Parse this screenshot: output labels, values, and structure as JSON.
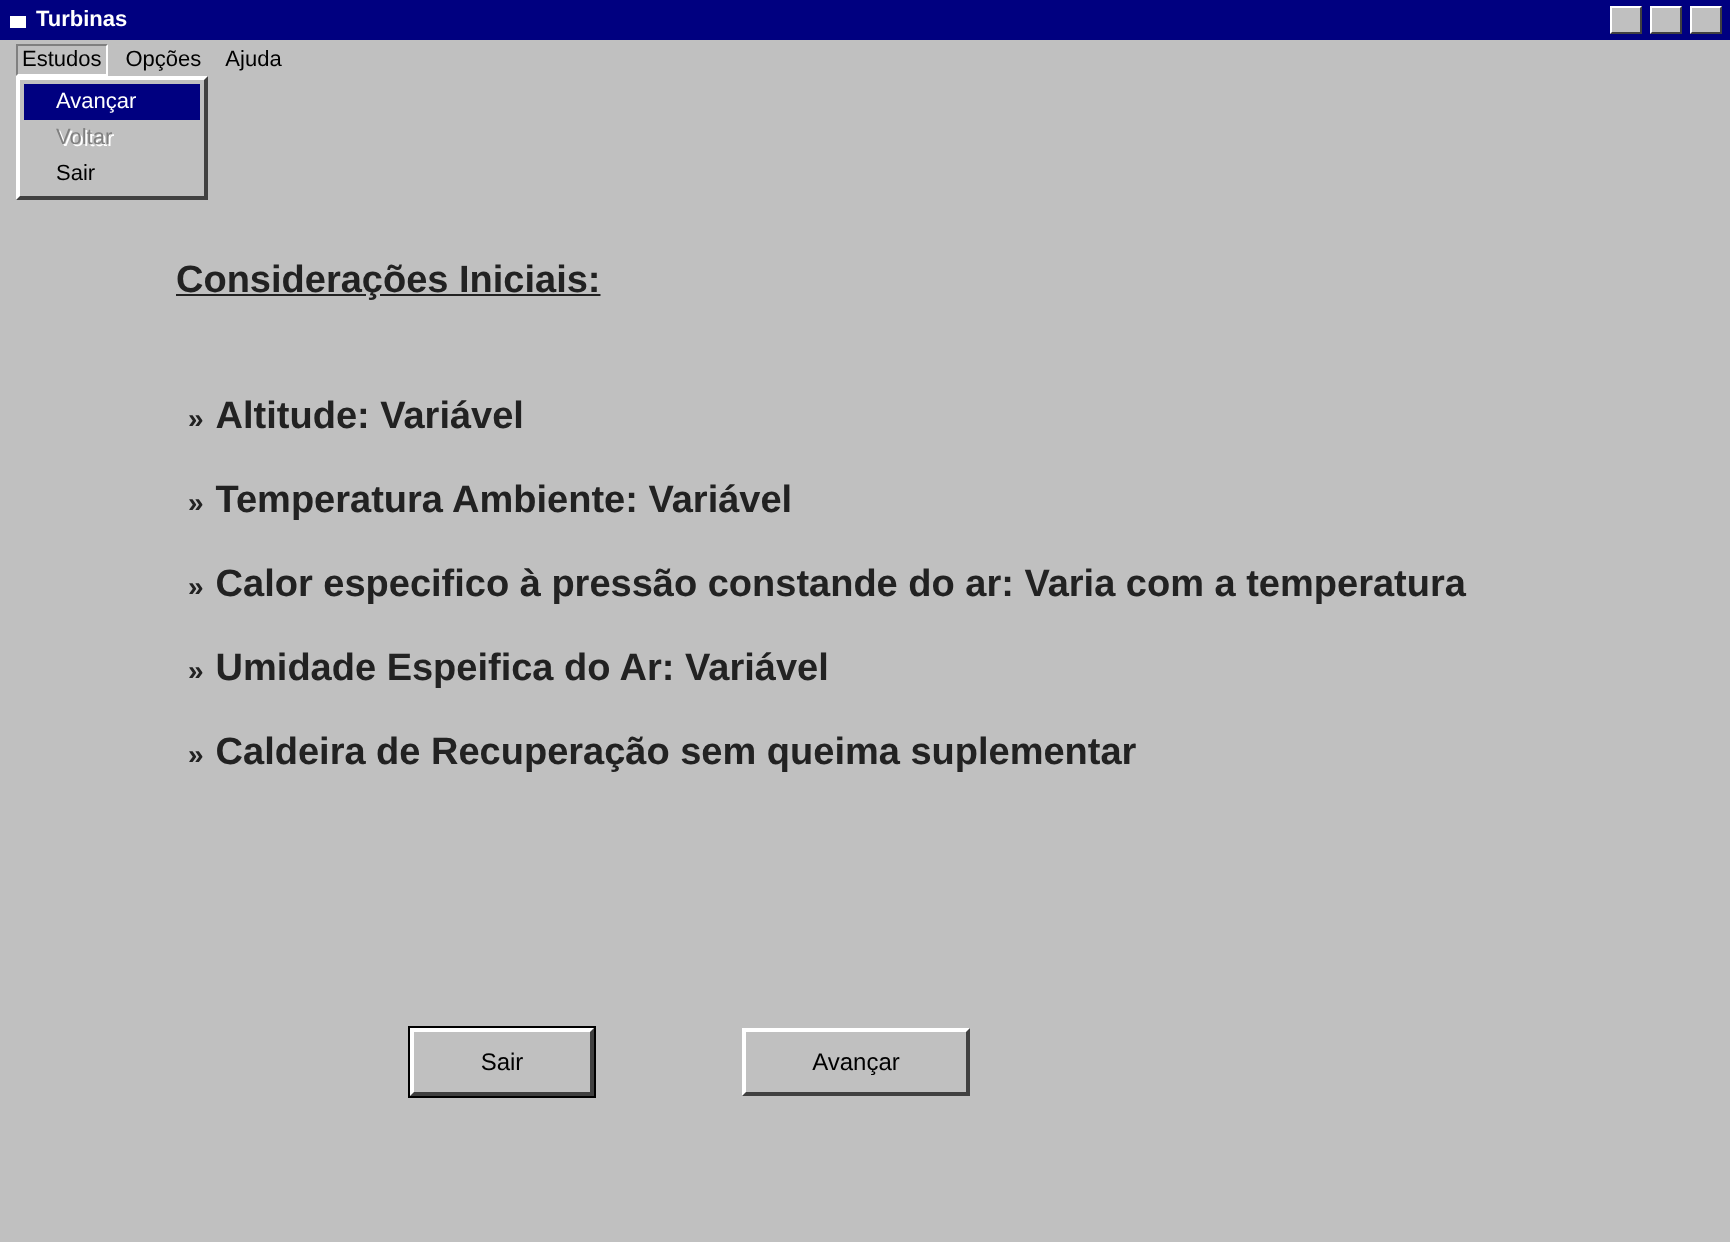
{
  "window": {
    "title": "Turbinas"
  },
  "menu": [
    {
      "label": "Estudos",
      "open": true
    },
    {
      "label": "Opções",
      "open": false
    },
    {
      "label": "Ajuda",
      "open": false
    }
  ],
  "dropdown": [
    {
      "label": "Avançar",
      "selected": true,
      "disabled": false
    },
    {
      "label": "Voltar",
      "selected": false,
      "disabled": true
    },
    {
      "label": "Sair",
      "selected": false,
      "disabled": false
    }
  ],
  "heading": "Considerações Iniciais:",
  "items": [
    "Altitude: Variável",
    "Temperatura Ambiente: Variável",
    "Calor especifico à pressão constande do ar: Varia com a temperatura",
    "Umidade Espeifica do Ar: Variável",
    "Caldeira de Recuperação sem queima suplementar"
  ],
  "bullet": "»",
  "buttons": [
    {
      "label": "Sair",
      "default": true
    },
    {
      "label": "Avançar",
      "default": false
    }
  ]
}
